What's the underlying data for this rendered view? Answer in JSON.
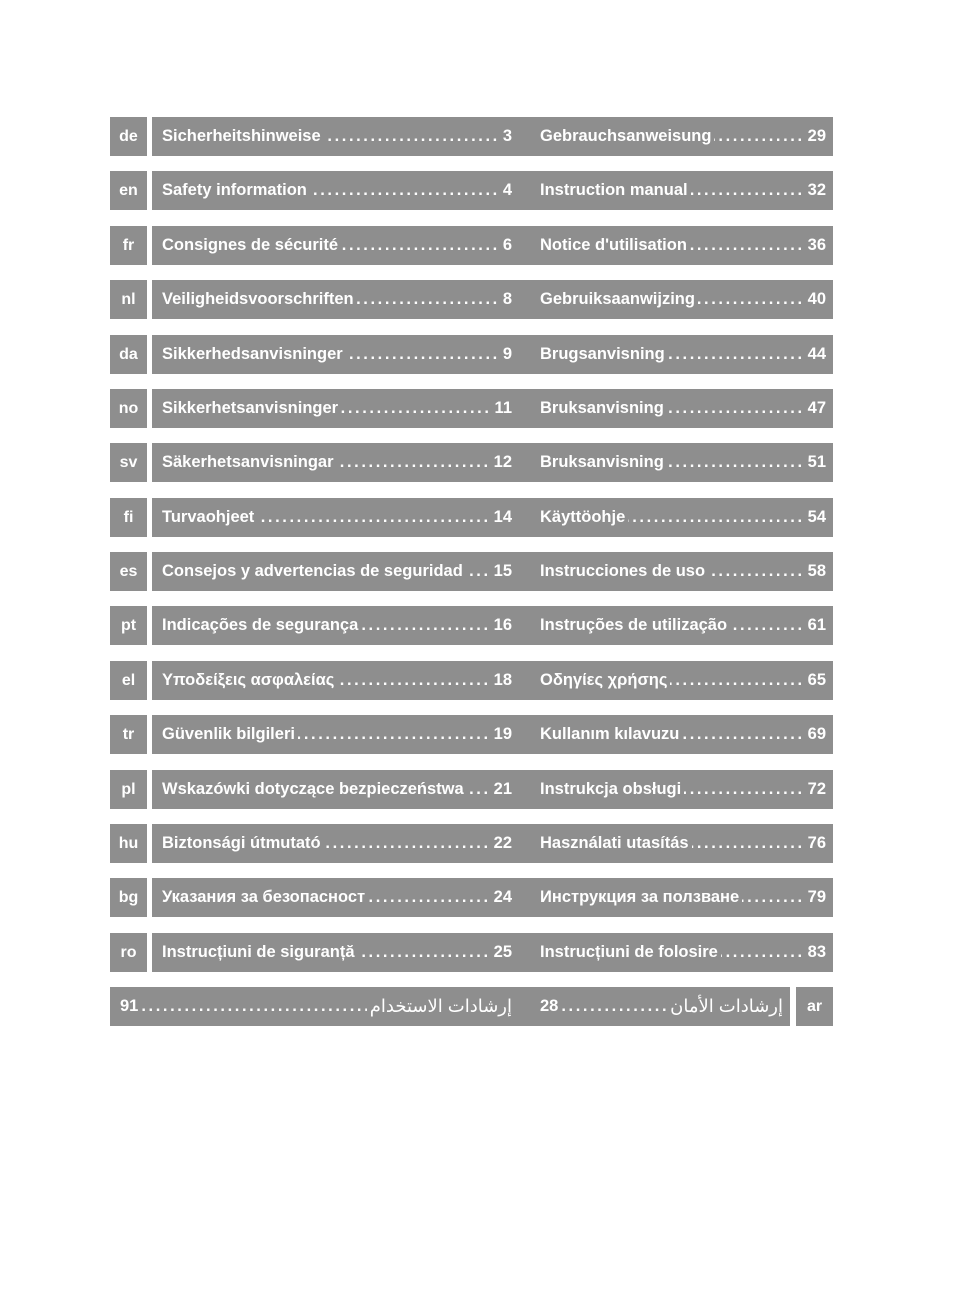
{
  "toc": {
    "rows": [
      {
        "lang": "de",
        "safety": {
          "title": "Sicherheitshinweise",
          "page": "3"
        },
        "manual": {
          "title": "Gebrauchsanweisung",
          "page": "29"
        }
      },
      {
        "lang": "en",
        "safety": {
          "title": "Safety information",
          "page": "4"
        },
        "manual": {
          "title": "Instruction manual",
          "page": "32"
        }
      },
      {
        "lang": "fr",
        "safety": {
          "title": "Consignes de sécurité",
          "page": "6"
        },
        "manual": {
          "title": "Notice d'utilisation",
          "page": "36"
        }
      },
      {
        "lang": "nl",
        "safety": {
          "title": "Veiligheidsvoorschriften",
          "page": "8"
        },
        "manual": {
          "title": "Gebruiksaanwijzing",
          "page": "40"
        }
      },
      {
        "lang": "da",
        "safety": {
          "title": "Sikkerhedsanvisninger",
          "page": "9"
        },
        "manual": {
          "title": "Brugsanvisning",
          "page": "44"
        }
      },
      {
        "lang": "no",
        "safety": {
          "title": "Sikkerhetsanvisninger",
          "page": "11"
        },
        "manual": {
          "title": "Bruksanvisning",
          "page": "47"
        }
      },
      {
        "lang": "sv",
        "safety": {
          "title": "Säkerhetsanvisningar",
          "page": "12"
        },
        "manual": {
          "title": "Bruksanvisning",
          "page": "51"
        }
      },
      {
        "lang": "fi",
        "safety": {
          "title": "Turvaohjeet",
          "page": "14"
        },
        "manual": {
          "title": "Käyttöohje",
          "page": "54"
        }
      },
      {
        "lang": "es",
        "safety": {
          "title": "Consejos y advertencias de seguridad",
          "page": "15"
        },
        "manual": {
          "title": "Instrucciones de uso",
          "page": "58"
        }
      },
      {
        "lang": "pt",
        "safety": {
          "title": "Indicações de segurança",
          "page": "16"
        },
        "manual": {
          "title": "Instruções de utilização",
          "page": "61"
        }
      },
      {
        "lang": "el",
        "safety": {
          "title": "Υποδείξεις ασφαλείας",
          "page": "18"
        },
        "manual": {
          "title": "Οδηγίες χρήσης",
          "page": "65"
        }
      },
      {
        "lang": "tr",
        "safety": {
          "title": "Güvenlik bilgileri",
          "page": "19"
        },
        "manual": {
          "title": "Kullanım kılavuzu",
          "page": "69"
        }
      },
      {
        "lang": "pl",
        "safety": {
          "title": "Wskazówki dotyczące bezpieczeństwa",
          "page": "21"
        },
        "manual": {
          "title": "Instrukcja obsługi",
          "page": "72"
        }
      },
      {
        "lang": "hu",
        "safety": {
          "title": "Biztonsági útmutató",
          "page": "22"
        },
        "manual": {
          "title": "Használati utasítás",
          "page": "76"
        }
      },
      {
        "lang": "bg",
        "safety": {
          "title": "Указания за безопасност",
          "page": "24"
        },
        "manual": {
          "title": "Инструкция за ползване",
          "page": "79"
        }
      },
      {
        "lang": "ro",
        "safety": {
          "title": "Instrucțiuni de siguranță",
          "page": "25"
        },
        "manual": {
          "title": "Instrucțiuni de folosire",
          "page": "83"
        }
      }
    ],
    "arabic_row": {
      "lang": "ar",
      "manual": {
        "title": "إرشادات الاستخدام",
        "page": "91"
      },
      "safety": {
        "title": "إرشادات الأمان",
        "page": "28"
      }
    },
    "leader": "........................................................................"
  }
}
